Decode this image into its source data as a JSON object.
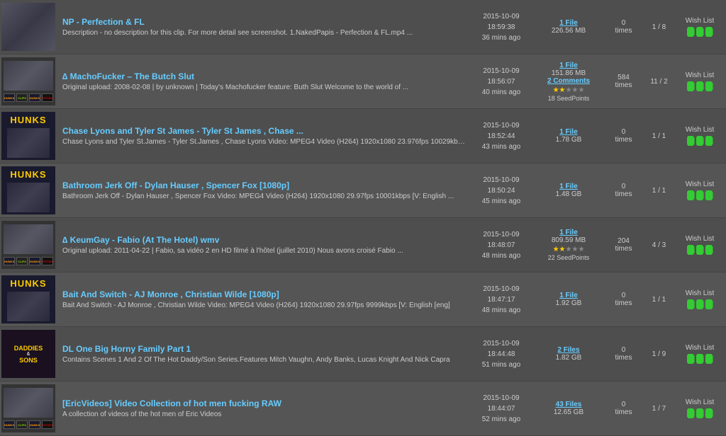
{
  "rows": [
    {
      "id": "row1",
      "title": "NP - Perfection & FL",
      "title_link": "#",
      "desc": "Description - no description for this clip. For more detail see screenshot. 1.NakedPapis - Perfection & FL.mp4 ...",
      "thumbnail_type": "plain",
      "date": "2015-10-09",
      "time": "18:59:38",
      "ago": "36 mins ago",
      "file_label": "1 File",
      "file_size": "226.56 MB",
      "has_comments": false,
      "comments_label": "",
      "has_stars": false,
      "stars": 0,
      "seed_points": 0,
      "times_label": "0",
      "times_text": "times",
      "pages": "1 / 8",
      "wishlist": "Wish List"
    },
    {
      "id": "row2",
      "title": "∆ MachoFucker – The Butch Slut",
      "title_link": "#",
      "desc": "Original upload: 2008-02-08 | by unknown | Today's Machofucker feature: Buth Slut Welcome to the world of ...",
      "thumbnail_type": "mini-thumbs",
      "thumbnails": [
        "hunks",
        "clips",
        "hunks",
        "fetish"
      ],
      "date": "2015-10-09",
      "time": "18:56:07",
      "ago": "40 mins ago",
      "file_label": "1 File",
      "file_size": "151.86 MB",
      "has_comments": true,
      "comments_label": "2 Comments",
      "has_stars": true,
      "stars": 2,
      "seed_points": 18,
      "times_label": "584",
      "times_text": "times",
      "pages": "11 / 2",
      "wishlist": "Wish List"
    },
    {
      "id": "row3",
      "title": "Chase Lyons and Tyler St James - Tyler St James , Chase ...",
      "title_link": "#",
      "desc": "Chase Lyons and Tyler St.James - Tyler St.James , Chase Lyons Video: MPEG4 Video (H264) 1920x1080 23.976fps 10029kbps ...",
      "thumbnail_type": "hunks-main",
      "date": "2015-10-09",
      "time": "18:52:44",
      "ago": "43 mins ago",
      "file_label": "1 File",
      "file_size": "1.78 GB",
      "has_comments": false,
      "comments_label": "",
      "has_stars": false,
      "stars": 0,
      "seed_points": 0,
      "times_label": "0",
      "times_text": "times",
      "pages": "1 / 1",
      "wishlist": "Wish List"
    },
    {
      "id": "row4",
      "title": "Bathroom Jerk Off - Dylan Hauser , Spencer Fox [1080p]",
      "title_link": "#",
      "desc": "Bathroom Jerk Off - Dylan Hauser , Spencer Fox Video: MPEG4 Video (H264) 1920x1080 29.97fps 10001kbps [V: English ...",
      "thumbnail_type": "hunks-main",
      "date": "2015-10-09",
      "time": "18:50:24",
      "ago": "45 mins ago",
      "file_label": "1 File",
      "file_size": "1.48 GB",
      "has_comments": false,
      "comments_label": "",
      "has_stars": false,
      "stars": 0,
      "seed_points": 0,
      "times_label": "0",
      "times_text": "times",
      "pages": "1 / 1",
      "wishlist": "Wish List"
    },
    {
      "id": "row5",
      "title": "∆ KeumGay - Fabio (At The Hotel) wmv",
      "title_link": "#",
      "desc": "Original upload: 2011-04-22 | Fabio, sa vidéo 2 en HD filmé à l'hôtel (juillet 2010) Nous avons croisé Fabio ...",
      "thumbnail_type": "mini-thumbs",
      "thumbnails": [
        "hunks",
        "fetish"
      ],
      "date": "2015-10-09",
      "time": "18:48:07",
      "ago": "48 mins ago",
      "file_label": "1 File",
      "file_size": "809.59 MB",
      "has_comments": false,
      "comments_label": "",
      "has_stars": true,
      "stars": 2,
      "seed_points": 22,
      "times_label": "204",
      "times_text": "times",
      "pages": "4 / 3",
      "wishlist": "Wish List"
    },
    {
      "id": "row6",
      "title": "Bait And Switch - AJ Monroe , Christian Wilde [1080p]",
      "title_link": "#",
      "desc": "Bait And Switch - AJ Monroe , Christian Wilde Video: MPEG4 Video (H264) 1920x1080 29.97fps 9999kbps [V: English [eng]",
      "thumbnail_type": "hunks-main",
      "date": "2015-10-09",
      "time": "18:47:17",
      "ago": "48 mins ago",
      "file_label": "1 File",
      "file_size": "1.92 GB",
      "has_comments": false,
      "comments_label": "",
      "has_stars": false,
      "stars": 0,
      "seed_points": 0,
      "times_label": "0",
      "times_text": "times",
      "pages": "1 / 1",
      "wishlist": "Wish List"
    },
    {
      "id": "row7",
      "title": "DL One Big Horny Family Part 1",
      "title_link": "#",
      "desc": "Contains Scenes 1 And 2 Of The Hot Daddy/Son Series.Features Mitch Vaughn, Andy Banks, Lucas Knight And Nick Capra",
      "thumbnail_type": "daddies",
      "date": "2015-10-09",
      "time": "18:44:48",
      "ago": "51 mins ago",
      "file_label": "2 Files",
      "file_size": "1.82 GB",
      "has_comments": false,
      "comments_label": "",
      "has_stars": false,
      "stars": 0,
      "seed_points": 0,
      "times_label": "0",
      "times_text": "times",
      "pages": "1 / 9",
      "wishlist": "Wish List"
    },
    {
      "id": "row8",
      "title": "[EricVideos] Video Collection of hot men fucking RAW",
      "title_link": "#",
      "desc": "A collection of videos of the hot men of Eric Videos",
      "thumbnail_type": "mini-thumbs",
      "thumbnails": [
        "hunks",
        "clips",
        "hunks",
        "fetish"
      ],
      "date": "2015-10-09",
      "time": "18:44:07",
      "ago": "52 mins ago",
      "file_label": "43 Files",
      "file_size": "12.65 GB",
      "has_comments": false,
      "comments_label": "",
      "has_stars": false,
      "stars": 0,
      "seed_points": 0,
      "times_label": "0",
      "times_text": "times",
      "pages": "1 / 7",
      "wishlist": "Wish List"
    }
  ]
}
